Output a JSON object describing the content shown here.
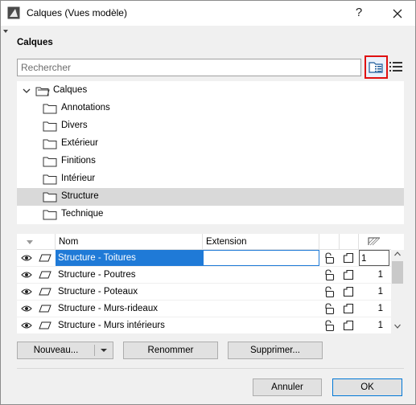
{
  "window": {
    "title": "Calques (Vues modèle)",
    "help_label": "?"
  },
  "section": {
    "title": "Calques"
  },
  "search": {
    "placeholder": "Rechercher"
  },
  "tree": {
    "root": "Calques",
    "items": [
      {
        "label": "Annotations"
      },
      {
        "label": "Divers"
      },
      {
        "label": "Extérieur"
      },
      {
        "label": "Finitions"
      },
      {
        "label": "Intérieur"
      },
      {
        "label": "Structure",
        "selected": true
      },
      {
        "label": "Technique"
      }
    ]
  },
  "table": {
    "headers": {
      "name": "Nom",
      "extension": "Extension"
    },
    "rows": [
      {
        "name": "Structure - Toitures",
        "extension": "",
        "number": "1",
        "selected": true
      },
      {
        "name": "Structure - Poutres",
        "extension": "",
        "number": "1"
      },
      {
        "name": "Structure - Poteaux",
        "extension": "",
        "number": "1"
      },
      {
        "name": "Structure - Murs-rideaux",
        "extension": "",
        "number": "1"
      },
      {
        "name": "Structure - Murs intérieurs",
        "extension": "",
        "number": "1"
      }
    ]
  },
  "buttons": {
    "new": "Nouveau...",
    "rename": "Renommer",
    "delete": "Supprimer...",
    "cancel": "Annuler",
    "ok": "OK"
  },
  "colors": {
    "selection": "#1f7ad7",
    "highlight_border": "#e01010",
    "tree_selected": "#d9d9d9"
  }
}
